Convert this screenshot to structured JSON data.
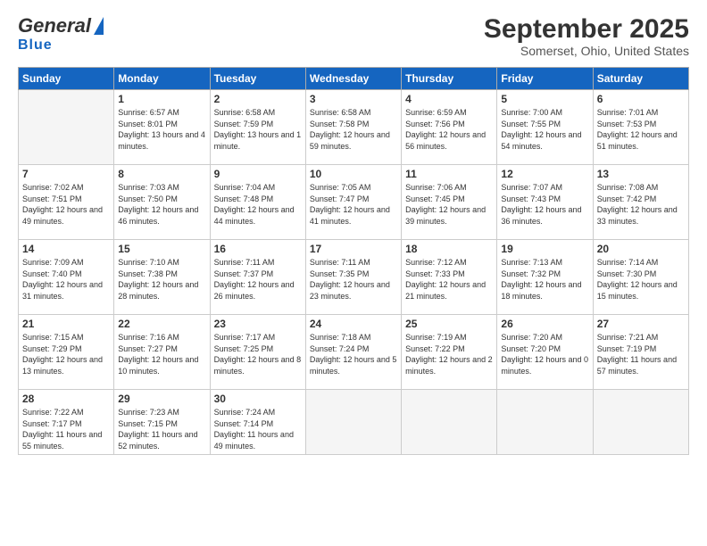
{
  "header": {
    "logo_general": "General",
    "logo_blue": "Blue",
    "month_title": "September 2025",
    "location": "Somerset, Ohio, United States"
  },
  "days_header": [
    "Sunday",
    "Monday",
    "Tuesday",
    "Wednesday",
    "Thursday",
    "Friday",
    "Saturday"
  ],
  "weeks": [
    [
      {
        "num": "",
        "empty": true
      },
      {
        "num": "1",
        "sunrise": "Sunrise: 6:57 AM",
        "sunset": "Sunset: 8:01 PM",
        "daylight": "Daylight: 13 hours and 4 minutes."
      },
      {
        "num": "2",
        "sunrise": "Sunrise: 6:58 AM",
        "sunset": "Sunset: 7:59 PM",
        "daylight": "Daylight: 13 hours and 1 minute."
      },
      {
        "num": "3",
        "sunrise": "Sunrise: 6:58 AM",
        "sunset": "Sunset: 7:58 PM",
        "daylight": "Daylight: 12 hours and 59 minutes."
      },
      {
        "num": "4",
        "sunrise": "Sunrise: 6:59 AM",
        "sunset": "Sunset: 7:56 PM",
        "daylight": "Daylight: 12 hours and 56 minutes."
      },
      {
        "num": "5",
        "sunrise": "Sunrise: 7:00 AM",
        "sunset": "Sunset: 7:55 PM",
        "daylight": "Daylight: 12 hours and 54 minutes."
      },
      {
        "num": "6",
        "sunrise": "Sunrise: 7:01 AM",
        "sunset": "Sunset: 7:53 PM",
        "daylight": "Daylight: 12 hours and 51 minutes."
      }
    ],
    [
      {
        "num": "7",
        "sunrise": "Sunrise: 7:02 AM",
        "sunset": "Sunset: 7:51 PM",
        "daylight": "Daylight: 12 hours and 49 minutes."
      },
      {
        "num": "8",
        "sunrise": "Sunrise: 7:03 AM",
        "sunset": "Sunset: 7:50 PM",
        "daylight": "Daylight: 12 hours and 46 minutes."
      },
      {
        "num": "9",
        "sunrise": "Sunrise: 7:04 AM",
        "sunset": "Sunset: 7:48 PM",
        "daylight": "Daylight: 12 hours and 44 minutes."
      },
      {
        "num": "10",
        "sunrise": "Sunrise: 7:05 AM",
        "sunset": "Sunset: 7:47 PM",
        "daylight": "Daylight: 12 hours and 41 minutes."
      },
      {
        "num": "11",
        "sunrise": "Sunrise: 7:06 AM",
        "sunset": "Sunset: 7:45 PM",
        "daylight": "Daylight: 12 hours and 39 minutes."
      },
      {
        "num": "12",
        "sunrise": "Sunrise: 7:07 AM",
        "sunset": "Sunset: 7:43 PM",
        "daylight": "Daylight: 12 hours and 36 minutes."
      },
      {
        "num": "13",
        "sunrise": "Sunrise: 7:08 AM",
        "sunset": "Sunset: 7:42 PM",
        "daylight": "Daylight: 12 hours and 33 minutes."
      }
    ],
    [
      {
        "num": "14",
        "sunrise": "Sunrise: 7:09 AM",
        "sunset": "Sunset: 7:40 PM",
        "daylight": "Daylight: 12 hours and 31 minutes."
      },
      {
        "num": "15",
        "sunrise": "Sunrise: 7:10 AM",
        "sunset": "Sunset: 7:38 PM",
        "daylight": "Daylight: 12 hours and 28 minutes."
      },
      {
        "num": "16",
        "sunrise": "Sunrise: 7:11 AM",
        "sunset": "Sunset: 7:37 PM",
        "daylight": "Daylight: 12 hours and 26 minutes."
      },
      {
        "num": "17",
        "sunrise": "Sunrise: 7:11 AM",
        "sunset": "Sunset: 7:35 PM",
        "daylight": "Daylight: 12 hours and 23 minutes."
      },
      {
        "num": "18",
        "sunrise": "Sunrise: 7:12 AM",
        "sunset": "Sunset: 7:33 PM",
        "daylight": "Daylight: 12 hours and 21 minutes."
      },
      {
        "num": "19",
        "sunrise": "Sunrise: 7:13 AM",
        "sunset": "Sunset: 7:32 PM",
        "daylight": "Daylight: 12 hours and 18 minutes."
      },
      {
        "num": "20",
        "sunrise": "Sunrise: 7:14 AM",
        "sunset": "Sunset: 7:30 PM",
        "daylight": "Daylight: 12 hours and 15 minutes."
      }
    ],
    [
      {
        "num": "21",
        "sunrise": "Sunrise: 7:15 AM",
        "sunset": "Sunset: 7:29 PM",
        "daylight": "Daylight: 12 hours and 13 minutes."
      },
      {
        "num": "22",
        "sunrise": "Sunrise: 7:16 AM",
        "sunset": "Sunset: 7:27 PM",
        "daylight": "Daylight: 12 hours and 10 minutes."
      },
      {
        "num": "23",
        "sunrise": "Sunrise: 7:17 AM",
        "sunset": "Sunset: 7:25 PM",
        "daylight": "Daylight: 12 hours and 8 minutes."
      },
      {
        "num": "24",
        "sunrise": "Sunrise: 7:18 AM",
        "sunset": "Sunset: 7:24 PM",
        "daylight": "Daylight: 12 hours and 5 minutes."
      },
      {
        "num": "25",
        "sunrise": "Sunrise: 7:19 AM",
        "sunset": "Sunset: 7:22 PM",
        "daylight": "Daylight: 12 hours and 2 minutes."
      },
      {
        "num": "26",
        "sunrise": "Sunrise: 7:20 AM",
        "sunset": "Sunset: 7:20 PM",
        "daylight": "Daylight: 12 hours and 0 minutes."
      },
      {
        "num": "27",
        "sunrise": "Sunrise: 7:21 AM",
        "sunset": "Sunset: 7:19 PM",
        "daylight": "Daylight: 11 hours and 57 minutes."
      }
    ],
    [
      {
        "num": "28",
        "sunrise": "Sunrise: 7:22 AM",
        "sunset": "Sunset: 7:17 PM",
        "daylight": "Daylight: 11 hours and 55 minutes."
      },
      {
        "num": "29",
        "sunrise": "Sunrise: 7:23 AM",
        "sunset": "Sunset: 7:15 PM",
        "daylight": "Daylight: 11 hours and 52 minutes."
      },
      {
        "num": "30",
        "sunrise": "Sunrise: 7:24 AM",
        "sunset": "Sunset: 7:14 PM",
        "daylight": "Daylight: 11 hours and 49 minutes."
      },
      {
        "num": "",
        "empty": true
      },
      {
        "num": "",
        "empty": true
      },
      {
        "num": "",
        "empty": true
      },
      {
        "num": "",
        "empty": true
      }
    ]
  ]
}
